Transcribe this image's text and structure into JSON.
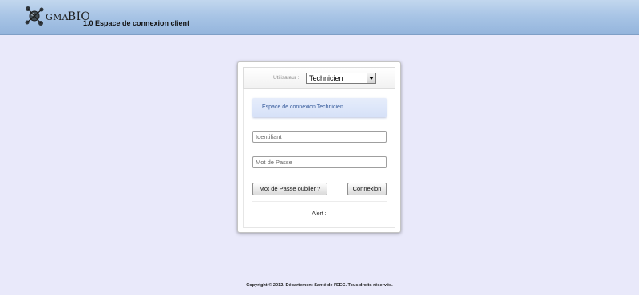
{
  "header": {
    "logo_icon": "molecule-logo-icon",
    "logo_text": "GMA",
    "logo_text_bio": "BIO",
    "title": "1.0 Espace de connexion client"
  },
  "login": {
    "user_label": "Utilisateur :",
    "user_select_value": "Technicien",
    "info_text": "Espace de connexion Technicien",
    "identifiant_placeholder": "Identifiant",
    "password_placeholder": "Mot de Passe",
    "forgot_button_label": "Mot de Passe oublier ?",
    "connect_button_label": "Connexion",
    "alert_label": "Alert :"
  },
  "footer": {
    "copyright": "Copyright © 2012. Département Santé de l'EEC. Tous droits réservés."
  },
  "colors": {
    "background": "#e9e9fa",
    "header_gradient": "#a9c5e6",
    "info_text": "#355a9a"
  }
}
